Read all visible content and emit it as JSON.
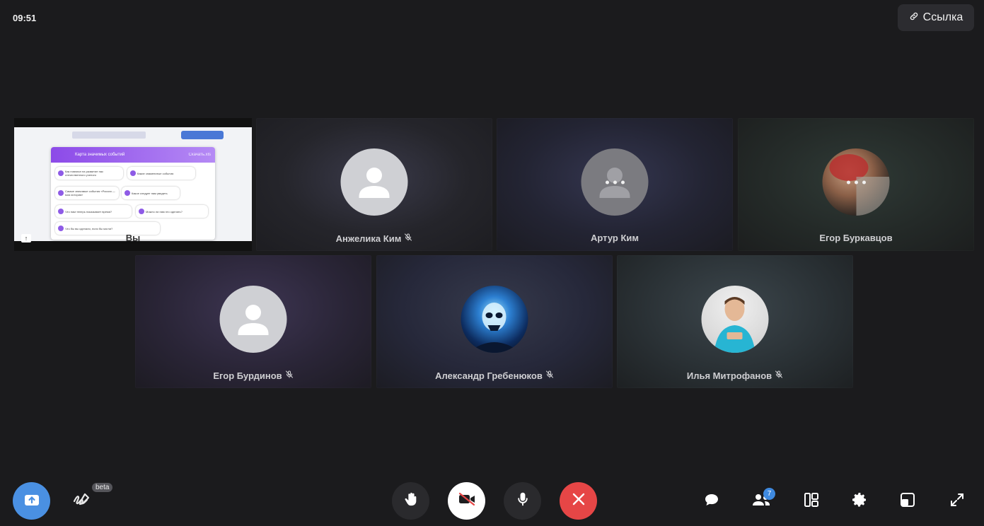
{
  "clock": "09:51",
  "link_button": {
    "label": "Ссылка",
    "icon": "link-icon"
  },
  "screen_share": {
    "label": "Вы",
    "modal_title": "Карта значимых событий",
    "modal_action": "Скачать.xls",
    "chips": [
      "Как повлиял на развитие нас отечественного ученого",
      "Какие знаменитые события",
      "Самые значимые события «Россия — моя история»",
      "Какое следует нам увидеть",
      "Что нам теперь показывает время?",
      "Можно ли нам это сделать?",
      "Что бы вы сделали, если бы могли?"
    ]
  },
  "participants": [
    {
      "name": "Анжелика Ким",
      "muted": true,
      "avatar": "default"
    },
    {
      "name": "Артур Ким",
      "muted": false,
      "avatar": "gray-speaking"
    },
    {
      "name": "Егор Буркавцов",
      "muted": false,
      "avatar": "photo-speaking"
    },
    {
      "name": "Егор Бурдинов",
      "muted": true,
      "avatar": "default"
    },
    {
      "name": "Александр Гребенюков",
      "muted": true,
      "avatar": "skull-art"
    },
    {
      "name": "Илья Митрофанов",
      "muted": true,
      "avatar": "photo-boy"
    }
  ],
  "toolbar": {
    "left": [
      "share-screen",
      "whiteboard"
    ],
    "beta_label": "beta",
    "center": [
      "raise-hand",
      "camera-off",
      "microphone",
      "end-call"
    ],
    "right": [
      "chat",
      "participants",
      "layout",
      "settings",
      "pip",
      "fullscreen"
    ],
    "participants_count": "7"
  },
  "colors": {
    "background": "#1b1b1d",
    "accent_blue": "#4a90e2",
    "end_call": "#e64646",
    "badge": "#3f8ae0"
  }
}
